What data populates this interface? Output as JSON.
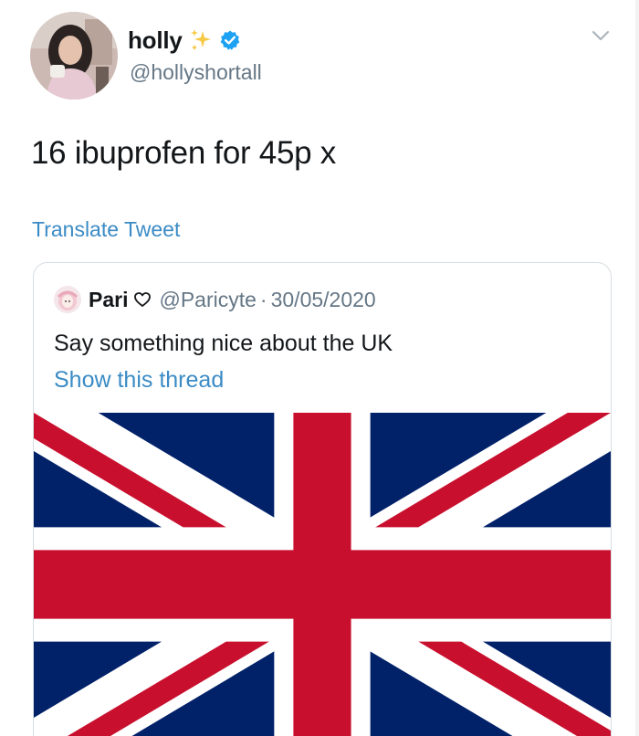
{
  "tweet": {
    "author": {
      "display_name": "holly",
      "handle": "@hollyshortall",
      "verified": true,
      "name_emoji": "sparkles-icon"
    },
    "text": "16 ibuprofen for 45p x",
    "translate_label": "Translate Tweet",
    "menu_icon": "chevron-down-icon"
  },
  "quoted_tweet": {
    "author": {
      "display_name": "Pari",
      "name_emoji": "heart-outline-icon",
      "handle": "@Paricyte",
      "separator": "·",
      "date": "30/05/2020"
    },
    "text": "Say something nice about the UK",
    "show_thread_label": "Show this thread",
    "media": "union-jack-flag-image"
  },
  "colors": {
    "link_blue": "#3b8bc5",
    "verified_blue": "#1da1f2",
    "secondary_text": "#657786",
    "primary_text": "#14171a",
    "flag_blue": "#012169",
    "flag_red": "#c8102e"
  }
}
